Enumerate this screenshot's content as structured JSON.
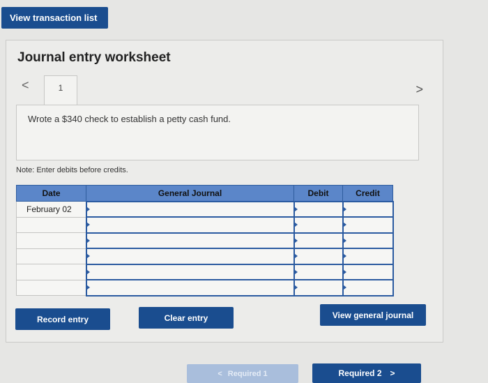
{
  "top_button": {
    "label": "View transaction list"
  },
  "worksheet": {
    "title": "Journal entry worksheet",
    "page_number": "1",
    "prev_icon": "<",
    "next_icon": ">",
    "description": "Wrote a $340 check to establish a petty cash fund.",
    "note": "Note: Enter debits before credits."
  },
  "table": {
    "headers": {
      "date": "Date",
      "journal": "General Journal",
      "debit": "Debit",
      "credit": "Credit"
    },
    "rows": [
      {
        "date": "February 02",
        "journal": "",
        "debit": "",
        "credit": ""
      },
      {
        "date": "",
        "journal": "",
        "debit": "",
        "credit": ""
      },
      {
        "date": "",
        "journal": "",
        "debit": "",
        "credit": ""
      },
      {
        "date": "",
        "journal": "",
        "debit": "",
        "credit": ""
      },
      {
        "date": "",
        "journal": "",
        "debit": "",
        "credit": ""
      },
      {
        "date": "",
        "journal": "",
        "debit": "",
        "credit": ""
      }
    ]
  },
  "actions": {
    "record": "Record entry",
    "clear": "Clear entry",
    "view_general_journal": "View general journal"
  },
  "footer": {
    "required1": "Required 1",
    "required1_icon": "<",
    "required2": "Required 2",
    "required2_icon": ">"
  },
  "colors": {
    "primary": "#1a4d8f",
    "header": "#5b86c9",
    "disabled": "#a9bedc"
  }
}
